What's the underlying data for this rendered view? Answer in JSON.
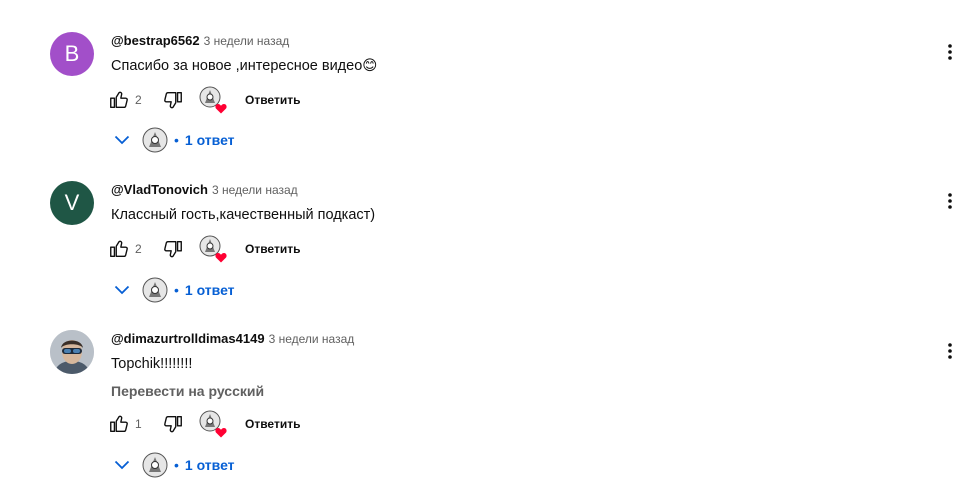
{
  "comments": [
    {
      "author": "@bestrap6562",
      "time": "3 недели назад",
      "text": "Спасибо за новое ,интересное видео😊",
      "avatar_letter": "B",
      "avatar_color": "#a24fc9",
      "likes": "2",
      "reply_label": "Ответить",
      "replies_label": "1 ответ"
    },
    {
      "author": "@VladTonovich",
      "time": "3 недели назад",
      "text": "Классный гость,качественный подкаст)",
      "avatar_letter": "V",
      "avatar_color": "#1f5645",
      "likes": "2",
      "reply_label": "Ответить",
      "replies_label": "1 ответ"
    },
    {
      "author": "@dimazurtrolldimas4149",
      "time": "3 недели назад",
      "text": "Topchik!!!!!!!!",
      "translate_label": "Перевести на русский",
      "likes": "1",
      "reply_label": "Ответить",
      "replies_label": "1 ответ"
    }
  ]
}
